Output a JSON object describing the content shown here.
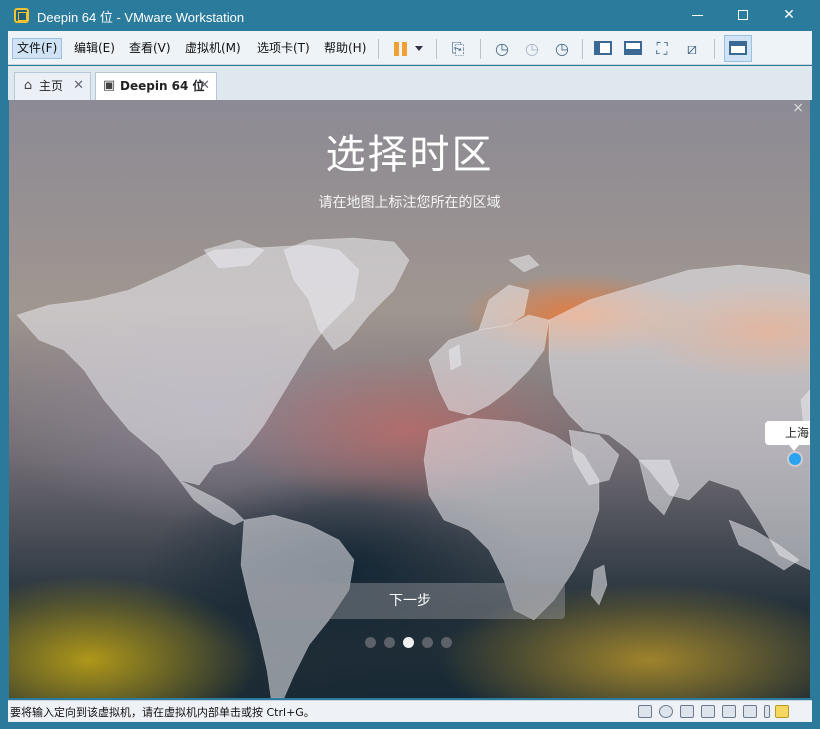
{
  "window": {
    "title": "Deepin 64 位 - VMware Workstation",
    "controls": [
      "minimize",
      "maximize",
      "close"
    ]
  },
  "menu": {
    "items": [
      {
        "label": "文件(F)",
        "active": true
      },
      {
        "label": "编辑(E)"
      },
      {
        "label": "查看(V)"
      },
      {
        "label": "虚拟机(M)"
      },
      {
        "label": "选项卡(T)"
      },
      {
        "label": "帮助(H)"
      }
    ]
  },
  "toolbar": {
    "icons": [
      "pause-icon",
      "dropdown-arrow-icon",
      "send-ctrl-alt-del-icon",
      "snapshot-take-icon",
      "snapshot-revert-icon",
      "snapshot-manager-icon",
      "show-library-icon",
      "thumbnail-bar-icon",
      "full-screen-icon",
      "unity-icon",
      "console-view-icon"
    ]
  },
  "tabs": [
    {
      "label": "主页",
      "icon": "home-icon",
      "active": false
    },
    {
      "label": "Deepin 64 位",
      "icon": "vm-icon",
      "active": true
    }
  ],
  "vm_screen": {
    "close_glyph": "×",
    "title": "选择时区",
    "subtitle": "请在地图上标注您所在的区域",
    "selected_city": "上海",
    "next_button": "下一步",
    "pager": {
      "total": 5,
      "current": 3
    }
  },
  "status": {
    "message": "要将输入定向到该虚拟机，请在虚拟机内部单击或按 Ctrl+G。",
    "icons": [
      "hard-disk-icon",
      "cd-rom-icon",
      "network-icon",
      "usb-icon",
      "printer-icon",
      "sound-icon",
      "display-icon",
      "message-log-icon"
    ]
  },
  "colors": {
    "titlebar": "#2b7b9c",
    "selected_dot": "#2aa3f0"
  }
}
